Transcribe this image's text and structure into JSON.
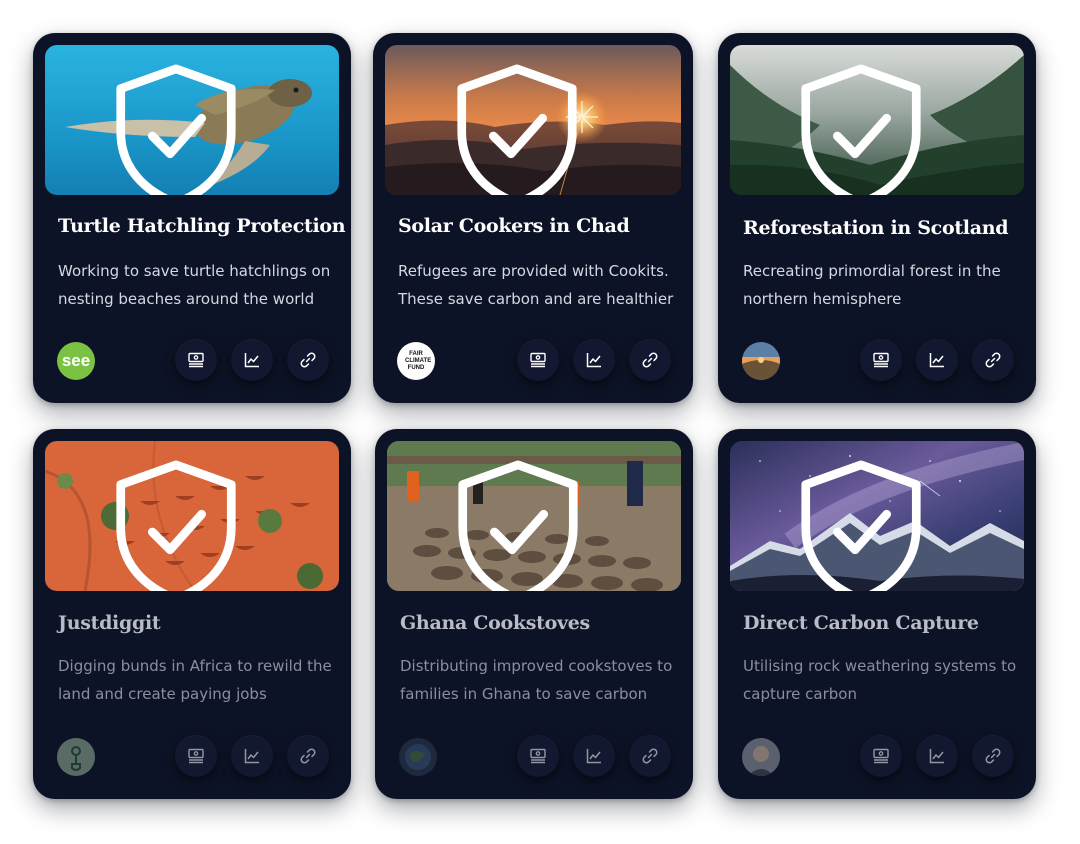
{
  "projects": [
    {
      "title": "Turtle Hatchling Protection",
      "description": "Working to save turtle hatchlings on nesting beaches around the world",
      "photo": "sea-turtle-underwater",
      "org_logo_text": "see",
      "verified": true
    },
    {
      "title": "Solar Cookers in Chad",
      "description": "Refugees are provided with Cookits. These save carbon and are healthier",
      "photo": "sunset-over-mountains",
      "org_logo_text": "FAIR CLIMATE FUND",
      "verified": true
    },
    {
      "title": "Reforestation in Scotland",
      "description": "Recreating primordial forest in the northern hemisphere",
      "photo": "misty-pine-forest",
      "org_logo_text": "",
      "verified": true
    },
    {
      "title": "Justdiggit",
      "description": "Digging bunds in Africa to rewild the land and create paying jobs",
      "photo": "aerial-red-earth-bunds",
      "org_logo_text": "",
      "verified": true
    },
    {
      "title": "Ghana Cookstoves",
      "description": "Distributing improved cookstoves to families in Ghana to save carbon",
      "photo": "cookstove-workshop",
      "org_logo_text": "",
      "verified": true
    },
    {
      "title": "Direct Carbon Capture",
      "description": "Utilising rock weathering systems to capture carbon",
      "photo": "milky-way-mountains",
      "org_logo_text": "",
      "verified": true
    }
  ],
  "action_icons": [
    "banknote-icon",
    "chart-icon",
    "link-icon"
  ],
  "colors": {
    "card_bg": "#0d1326",
    "button_bg": "#111830",
    "see_logo_green": "#7cc242"
  }
}
